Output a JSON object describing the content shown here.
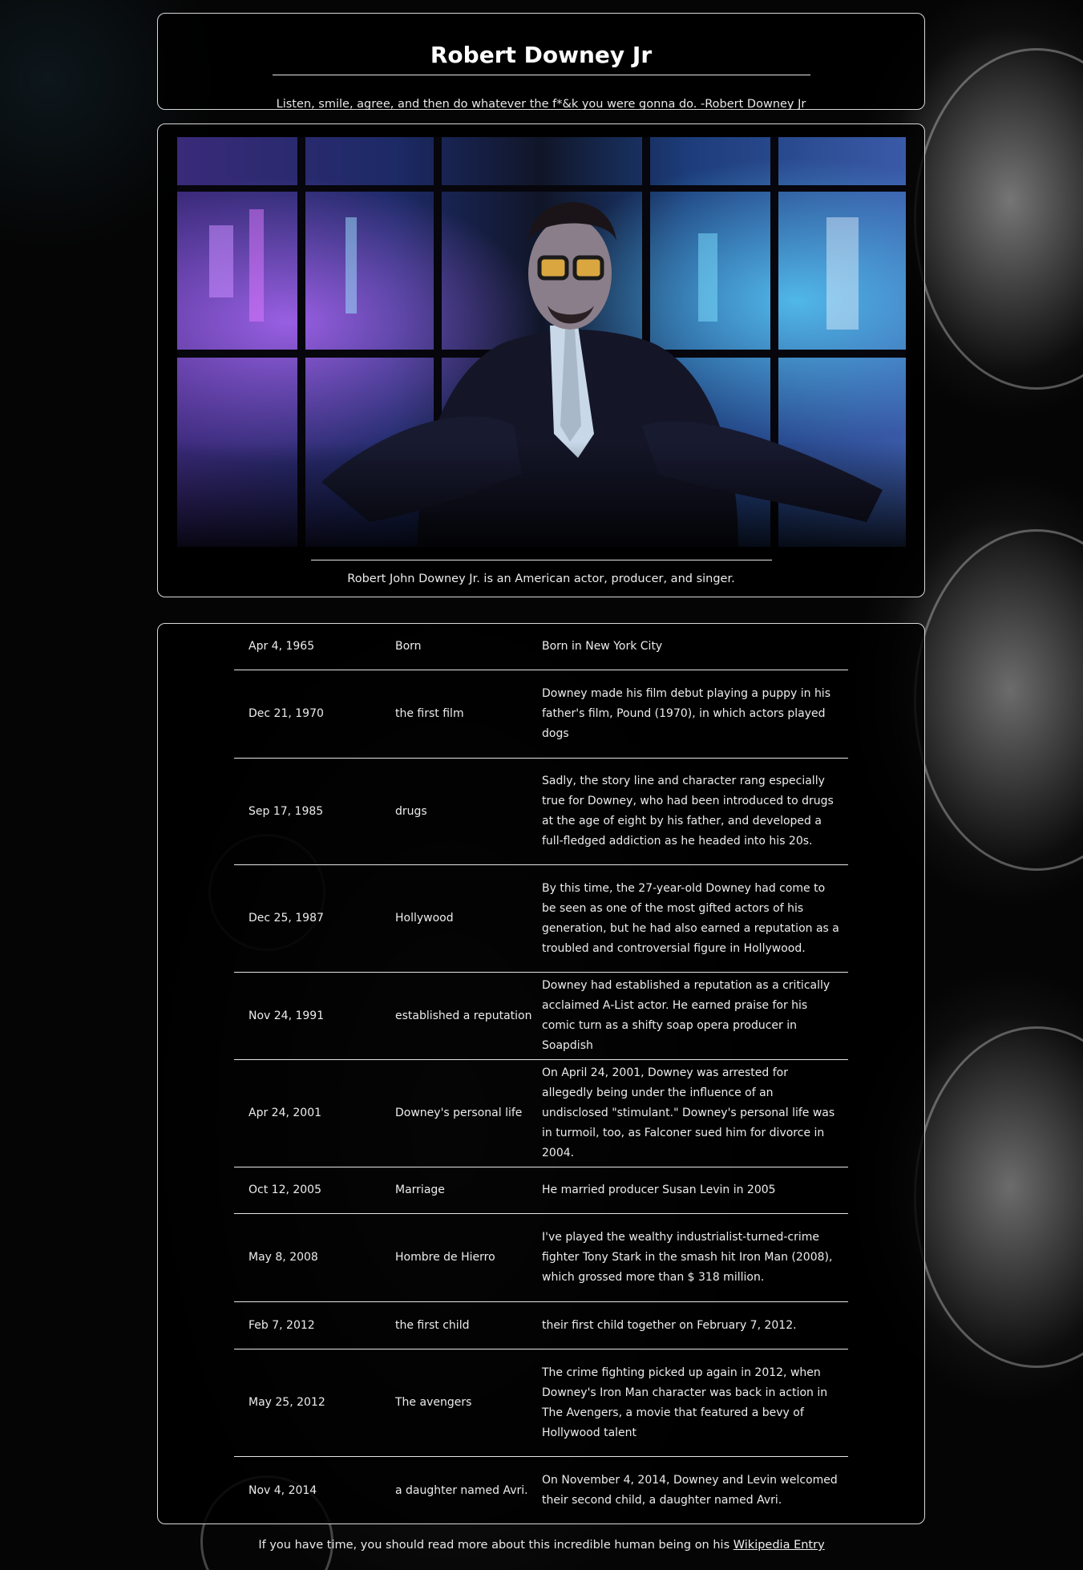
{
  "header": {
    "title": "Robert Downey Jr",
    "quote": "Listen, smile, agree, and then do whatever the f*&k you were gonna do. -Robert Downey Jr"
  },
  "image": {
    "caption": "Robert John Downey Jr. is an American actor, producer, and singer."
  },
  "timeline": [
    {
      "date": "Apr 4, 1965",
      "event": "Born",
      "description": "Born in New York City"
    },
    {
      "date": "Dec 21, 1970",
      "event": "the first film",
      "description": "Downey made his film debut playing a puppy in his father's film, Pound (1970), in which actors played dogs"
    },
    {
      "date": "Sep 17, 1985",
      "event": "drugs",
      "description": "Sadly, the story line and character rang especially true for Downey, who had been introduced to drugs at the age of eight by his father, and developed a full-fledged addiction as he headed into his 20s."
    },
    {
      "date": "Dec 25, 1987",
      "event": "Hollywood",
      "description": "By this time, the 27-year-old Downey had come to be seen as one of the most gifted actors of his generation, but he had also earned a reputation as a troubled and controversial figure in Hollywood."
    },
    {
      "date": "Nov 24, 1991",
      "event": "established a reputation",
      "description": "Downey had established a reputation as a critically acclaimed A-List actor. He earned praise for his comic turn as a shifty soap opera producer in Soapdish"
    },
    {
      "date": "Apr 24, 2001",
      "event": "Downey's personal life",
      "description": "On April 24, 2001, Downey was arrested for allegedly being under the influence of an undisclosed \"stimulant.\" Downey's personal life was in turmoil, too, as Falconer sued him for divorce in 2004."
    },
    {
      "date": "Oct 12, 2005",
      "event": "Marriage",
      "description": "He married producer Susan Levin in 2005"
    },
    {
      "date": "May 8, 2008",
      "event": "Hombre de Hierro",
      "description": "I've played the wealthy industrialist-turned-crime fighter Tony Stark in the smash hit Iron Man (2008), which grossed more than $ 318 million."
    },
    {
      "date": "Feb 7, 2012",
      "event": "the first child",
      "description": "their first child together on February 7, 2012."
    },
    {
      "date": "May 25, 2012",
      "event": "The avengers",
      "description": "The crime fighting picked up again in 2012, when Downey's Iron Man character was back in action in The Avengers, a movie that featured a bevy of Hollywood talent"
    },
    {
      "date": "Nov 4, 2014",
      "event": "a daughter named Avri.",
      "description": "On November 4, 2014, Downey and Levin welcomed their second child, a daughter named Avri."
    }
  ],
  "footer": {
    "text": "If you have time, you should read more about this incredible human being on his ",
    "link_label": "Wikipedia Entry"
  }
}
